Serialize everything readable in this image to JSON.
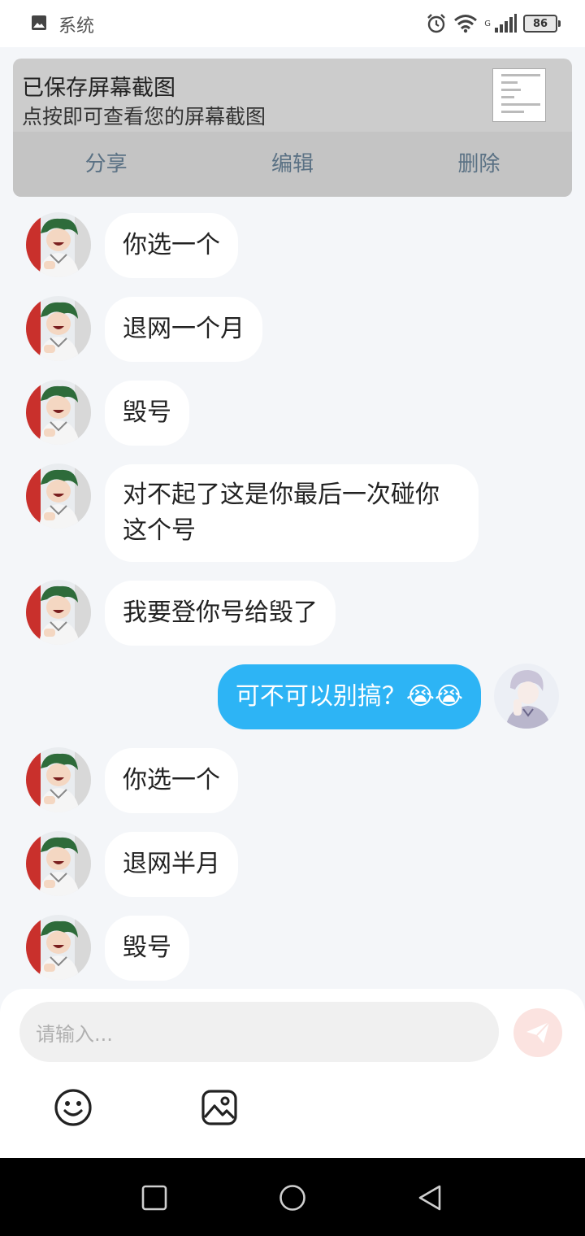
{
  "status_bar": {
    "notification_label": "系统",
    "network": "G",
    "battery": "86",
    "icons": [
      "image-icon",
      "alarm-icon",
      "wifi-icon",
      "signal-icon",
      "battery-icon"
    ]
  },
  "screenshot_notification": {
    "title": "已保存屏幕截图",
    "subtitle": "点按即可查看您的屏幕截图",
    "actions": {
      "share": "分享",
      "edit": "编辑",
      "delete": "删除"
    }
  },
  "chat": {
    "messages": [
      {
        "sender": "other",
        "text": "你选一个"
      },
      {
        "sender": "other",
        "text": "退网一个月"
      },
      {
        "sender": "other",
        "text": "毁号"
      },
      {
        "sender": "other",
        "text": "对不起了这是你最后一次碰你\n这个号"
      },
      {
        "sender": "other",
        "text": "我要登你号给毁了"
      },
      {
        "sender": "me",
        "text": "可不可以别搞？😭😭"
      },
      {
        "sender": "other",
        "text": "你选一个"
      },
      {
        "sender": "other",
        "text": "退网半月"
      },
      {
        "sender": "other",
        "text": "毁号"
      }
    ]
  },
  "composer": {
    "placeholder": "请输入...",
    "icons": [
      "send-icon",
      "emoji-icon",
      "image-picker-icon"
    ]
  },
  "nav_bar": {
    "icons": [
      "recents-icon",
      "home-icon",
      "back-icon"
    ]
  },
  "colors": {
    "my_bubble": "#2db4f5",
    "other_bubble": "#ffffff",
    "background": "#f4f6f9",
    "action_text": "#5a7184"
  }
}
